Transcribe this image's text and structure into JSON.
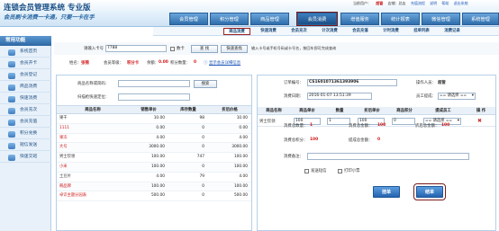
{
  "header": {
    "brand": "连锁会员管理系统 专业版",
    "slogan": "会员刷卡消费一卡通，只要一卡在手",
    "user_bar": [
      "当前用户：",
      "超管",
      "店铺：总店",
      "充值流程",
      "说明",
      "帮助",
      "退出系统"
    ],
    "nav": [
      {
        "label": "会员管理",
        "active": false
      },
      {
        "label": "积分管理",
        "active": false
      },
      {
        "label": "商品管理",
        "active": false
      },
      {
        "label": "会员消费",
        "active": true
      },
      {
        "label": "增值服务",
        "active": false
      },
      {
        "label": "统计报表",
        "active": false
      },
      {
        "label": "微信管理",
        "active": false
      },
      {
        "label": "系统管理",
        "active": false
      }
    ]
  },
  "subnav": [
    {
      "label": "商品消费",
      "active": true
    },
    {
      "label": "快速消费",
      "active": false
    },
    {
      "label": "会员充次",
      "active": false
    },
    {
      "label": "计次消费",
      "active": false
    },
    {
      "label": "会员充值",
      "active": false
    },
    {
      "label": "计时消费",
      "active": false
    },
    {
      "label": "挂单列表",
      "active": false
    },
    {
      "label": "消费记录",
      "active": false
    }
  ],
  "sidebar": {
    "title": "常用功能",
    "items": [
      "系统首页",
      "会员开卡",
      "会员登记",
      "商品消费",
      "快速消费",
      "会员充次",
      "会员充值",
      "积分兑换",
      "短信发送",
      "快速交班"
    ]
  },
  "search_row": {
    "card_label": "请输入卡号",
    "card_value": "7788",
    "digital_label": "数卡",
    "search_btn": "查 找",
    "fast_search_btn": "快速查找",
    "hint": "输入卡号或手机号码或卡号名，按回车即可完成查询"
  },
  "info_row": {
    "name_label": "姓名：",
    "name_value": "张锦",
    "level_label": "会员等级：",
    "level_value": "积分卡",
    "balance_label": "余额：",
    "balance_value": "0.00",
    "points_label": "积分数量：",
    "points_value": "0",
    "more_link": "显示会员详细信息"
  },
  "left_panel": {
    "name_label": "商品名称或简码：",
    "name_placeholder": "",
    "search_btn": "搜索",
    "scan_label": "扫描枪快速定位：",
    "columns": [
      "商品名称",
      "销售单价",
      "库存数量",
      "折后价格"
    ],
    "rows": [
      {
        "name": "果干",
        "price": "10.00",
        "stock": "98",
        "discount": "10.00",
        "color": "#333"
      },
      {
        "name": "1111",
        "price": "0.00",
        "stock": "0",
        "discount": "0.00",
        "color": "#d11818"
      },
      {
        "name": "果冻",
        "price": "4.00",
        "stock": "0",
        "discount": "4.00",
        "color": "#d11818"
      },
      {
        "name": "大号",
        "price": "3000.00",
        "stock": "0",
        "discount": "3000.00",
        "color": "#d11818"
      },
      {
        "name": "男士钦领",
        "price": "100.00",
        "stock": "747",
        "discount": "100.00",
        "color": "#333"
      },
      {
        "name": "小米",
        "price": "100.00",
        "stock": "0",
        "discount": "100.00",
        "color": "#d11818"
      },
      {
        "name": "土豆片",
        "price": "4.00",
        "stock": "79",
        "discount": "4.00",
        "color": "#333"
      },
      {
        "name": "韩品牌",
        "price": "100.00",
        "stock": "0",
        "discount": "100.00",
        "color": "#d11818"
      },
      {
        "name": "卓识主题分园表",
        "price": "500.00",
        "stock": "0",
        "discount": "500.00",
        "color": "#d11818"
      }
    ]
  },
  "right_panel": {
    "order_label": "订单编号：",
    "order_value": "CS1601071361393906",
    "operator_label": "操作人员：",
    "operator_value": "超管",
    "time_label": "消费日期：",
    "time_value": "2016-01-07 13:51:39",
    "staff_label": "员工提成：",
    "staff_value": "== 请选择 ==",
    "columns": [
      "商品名称",
      "商品单价",
      "数量",
      "折后单价",
      "商品积分",
      "提成员工",
      "操 作"
    ],
    "row": {
      "name": "男士钦领",
      "price": "100",
      "qty": "1",
      "discount": "100",
      "points": "0",
      "staff": "== 请选择 =="
    },
    "total_qty_label": "消费总数量：",
    "total_qty": "1",
    "total_amount_label": "消费总金额：",
    "total_amount": "100",
    "discount_total_label": "折后总金额：",
    "discount_total": "100",
    "total_points_label": "消费总积分：",
    "total_points": "100",
    "pay_label": "提成总金额：",
    "pay_value": "0",
    "note_label": "消费备注：",
    "sms_label": "发送短信",
    "print_label": "打印小票",
    "pending_btn": "挂单",
    "settle_btn": "结单"
  }
}
